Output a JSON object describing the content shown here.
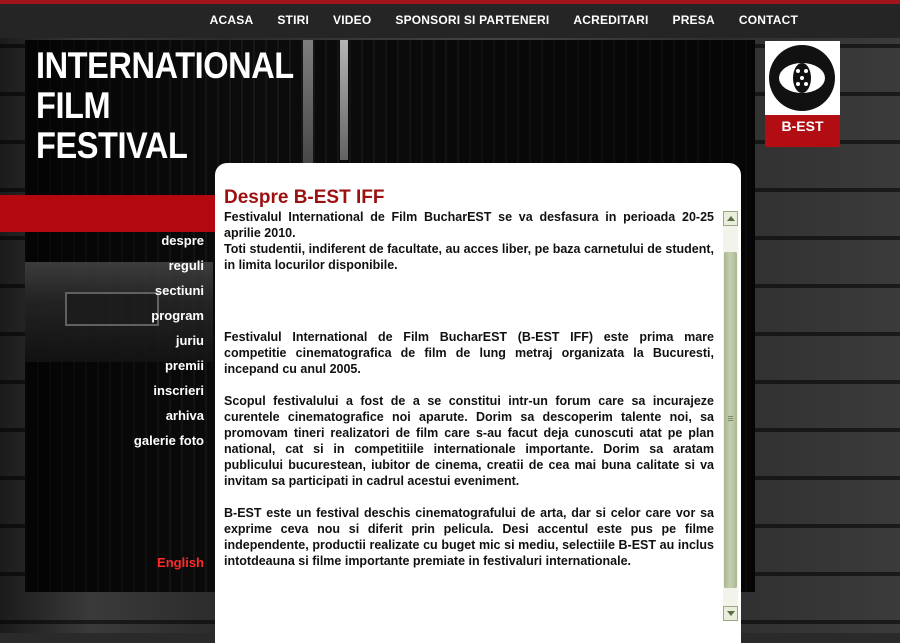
{
  "nav": {
    "items": [
      "ACASA",
      "STIRI",
      "VIDEO",
      "SPONSORI SI PARTENERI",
      "ACREDITARI",
      "PRESA",
      "CONTACT"
    ]
  },
  "header": {
    "title_lines": [
      "INTERNATIONAL",
      "FILM",
      "FESTIVAL"
    ]
  },
  "logo": {
    "text": "B-EST",
    "icon": "eye-film-reel-icon"
  },
  "sidebar": {
    "items": [
      "despre",
      "reguli",
      "sectiuni",
      "program",
      "juriu",
      "premii",
      "inscrieri",
      "arhiva",
      "galerie foto"
    ],
    "language_link": "English"
  },
  "content": {
    "title": "Despre B-EST IFF",
    "paragraphs": [
      "Festivalul International de Film BucharEST se va desfasura in perioada 20-25 aprilie 2010.",
      "Toti studentii, indiferent de facultate, au acces liber, pe baza carnetului de student, in limita locurilor disponibile.",
      "Festivalul International de Film BucharEST (B-EST IFF) este prima mare competitie cinematografica de film de lung metraj organizata la Bucuresti, incepand cu anul 2005.",
      "Scopul festivalului a fost de a se constitui intr-un forum care sa incurajeze curentele cinematografice noi aparute. Dorim sa descoperim talente noi, sa promovam tineri realizatori de film care s-au facut deja cunoscuti atat pe plan national, cat si in competitiile internationale importante. Dorim sa aratam publicului bucurestean, iubitor de cinema, creatii de cea mai buna calitate si va invitam sa participati in cadrul acestui eveniment.",
      "B-EST este un festival deschis cinematografului de arta, dar si celor care vor sa exprime ceva nou si diferit prin pelicula. Desi accentul este pus pe filme independente, productii realizate cu buget mic si mediu, selectiile B-EST au inclus intotdeauna si filme importante premiate in festivaluri internationale."
    ]
  },
  "colors": {
    "accent_red": "#b3080f",
    "title_red": "#9c1010",
    "scrollbar": "#a9b793"
  }
}
